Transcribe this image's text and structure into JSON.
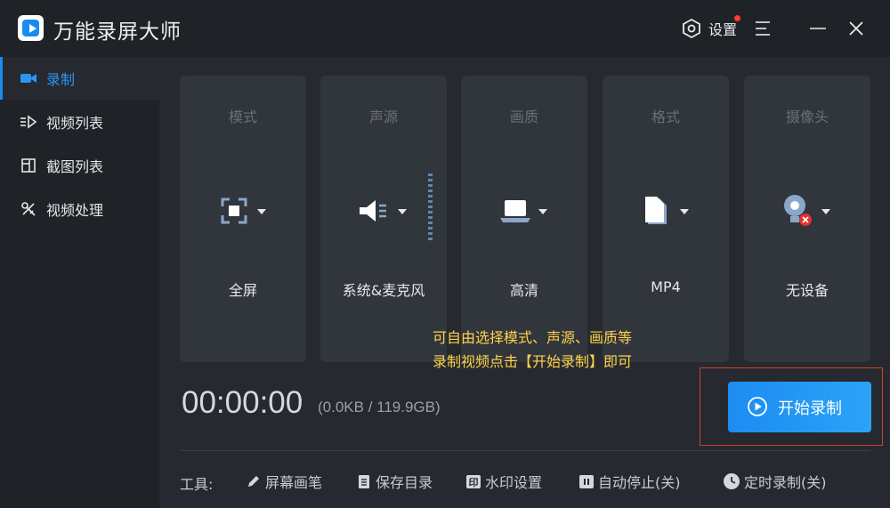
{
  "app": {
    "title": "万能录屏大师"
  },
  "titlebar": {
    "settings_label": "设置"
  },
  "sidebar": {
    "items": [
      {
        "label": "录制",
        "icon": "camera-icon",
        "active": true
      },
      {
        "label": "视频列表",
        "icon": "video-list-icon"
      },
      {
        "label": "截图列表",
        "icon": "screenshot-list-icon"
      },
      {
        "label": "视频处理",
        "icon": "video-tools-icon"
      }
    ]
  },
  "options": [
    {
      "header": "模式",
      "value": "全屏",
      "icon": "fullscreen-icon"
    },
    {
      "header": "声源",
      "value": "系统&麦克风",
      "icon": "speaker-mic-icon"
    },
    {
      "header": "画质",
      "value": "高清",
      "icon": "laptop-icon"
    },
    {
      "header": "格式",
      "value": "MP4",
      "icon": "file-icon"
    },
    {
      "header": "摄像头",
      "value": "无设备",
      "icon": "webcam-off-icon"
    }
  ],
  "tip": {
    "line1": "可自由选择模式、声源、画质等",
    "line2": "录制视频点击【开始录制】即可"
  },
  "timer": {
    "time": "00:00:00",
    "size": "(0.0KB / 119.9GB)"
  },
  "start_button": {
    "label": "开始录制"
  },
  "tools": {
    "label": "工具:",
    "items": [
      {
        "label": "屏幕画笔",
        "icon": "pen-icon"
      },
      {
        "label": "保存目录",
        "icon": "folder-list-icon"
      },
      {
        "label": "水印设置",
        "icon": "watermark-icon"
      },
      {
        "label": "自动停止(关)",
        "icon": "pause-icon"
      },
      {
        "label": "定时录制(关)",
        "icon": "clock-icon"
      }
    ]
  },
  "colors": {
    "accent": "#1a8cf0",
    "tip": "#ffd24a",
    "highlight_frame": "#d0412b"
  }
}
